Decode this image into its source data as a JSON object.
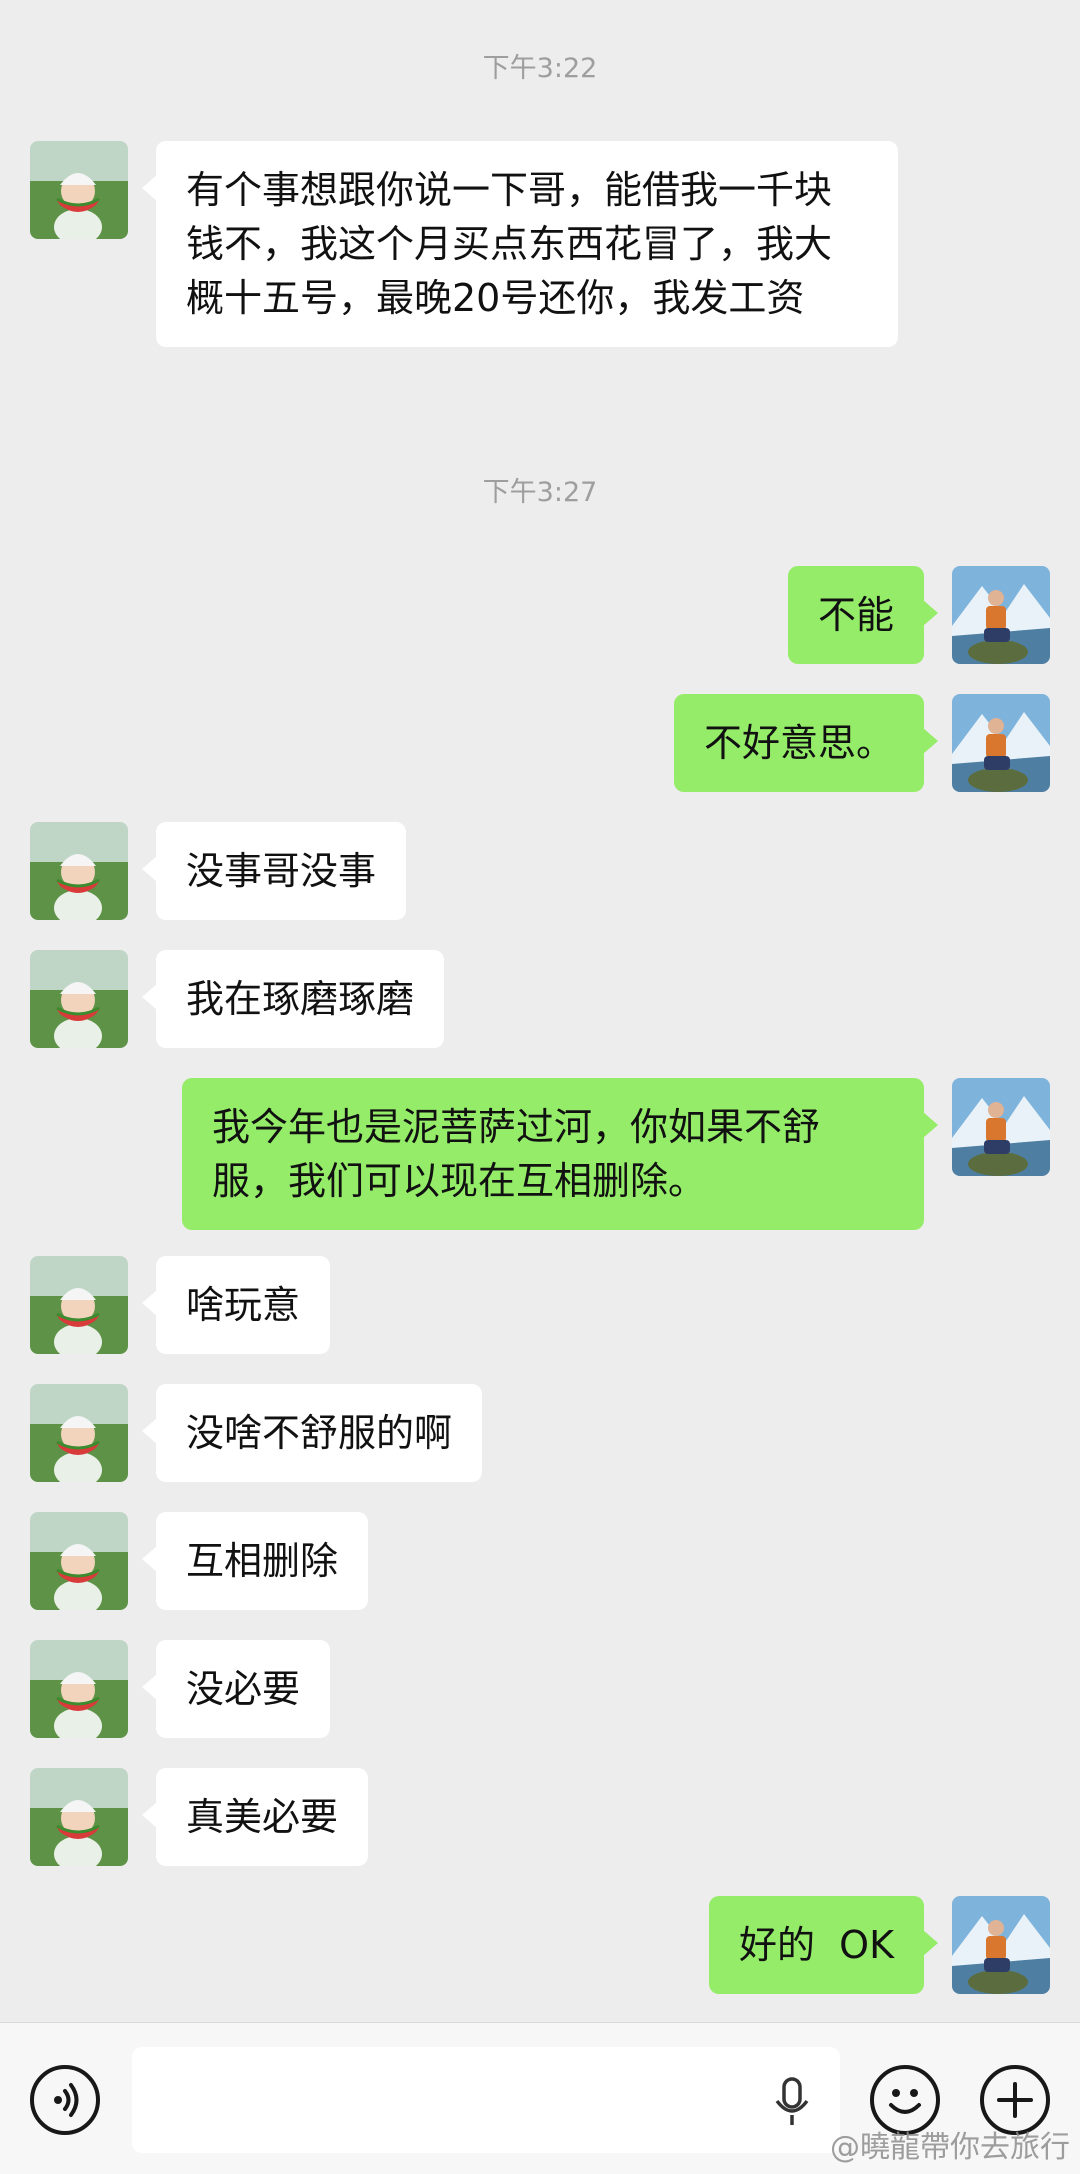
{
  "timestamps": [
    "下午3:22",
    "下午3:27"
  ],
  "messages": [
    {
      "from": "friend",
      "text": "有个事想跟你说一下哥，能借我一千块钱不，我这个月买点东西花冒了，我大概十五号，最晚20号还你，我发工资"
    },
    {
      "from": "me",
      "text": "不能"
    },
    {
      "from": "me",
      "text": "不好意思。"
    },
    {
      "from": "friend",
      "text": "没事哥没事"
    },
    {
      "from": "friend",
      "text": "我在琢磨琢磨"
    },
    {
      "from": "me",
      "text": "我今年也是泥菩萨过河，你如果不舒服，我们可以现在互相删除。"
    },
    {
      "from": "friend",
      "text": "啥玩意"
    },
    {
      "from": "friend",
      "text": "没啥不舒服的啊"
    },
    {
      "from": "friend",
      "text": "互相删除"
    },
    {
      "from": "friend",
      "text": "没必要"
    },
    {
      "from": "friend",
      "text": "真美必要"
    },
    {
      "from": "me",
      "text": "好的  OK"
    }
  ],
  "avatars": {
    "friend": "child-eating-watermelon-avatar",
    "me": "man-sitting-by-mountain-lake-avatar"
  },
  "input_bar": {
    "voice_icon": "voice-mode-icon",
    "mic_icon": "microphone-icon",
    "emoji_icon": "smiley-icon",
    "more_icon": "plus-icon",
    "input_value": ""
  },
  "watermark": "@曉龍帶你去旅行",
  "colors": {
    "background": "#EDEDED",
    "my_bubble": "#95EC69",
    "friend_bubble": "#FFFFFF",
    "timestamp": "#9E9E9E"
  }
}
